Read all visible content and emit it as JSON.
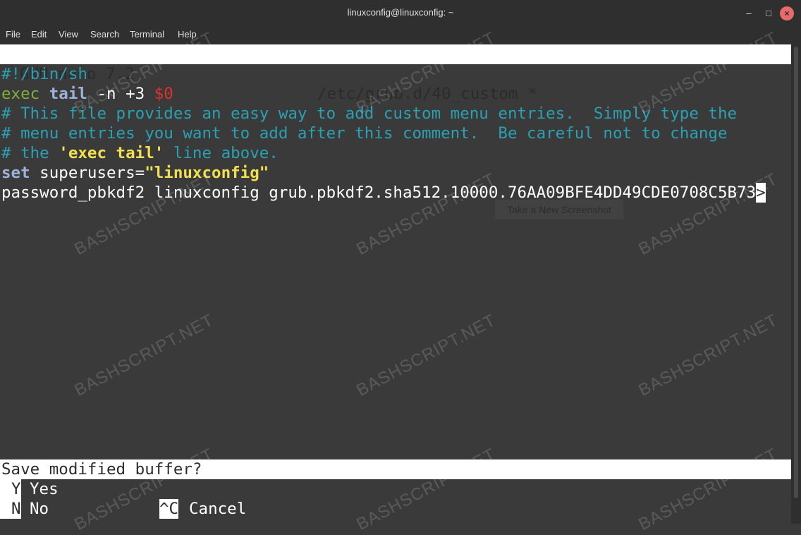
{
  "window": {
    "title": "linuxconfig@linuxconfig: ~"
  },
  "menu": [
    "File",
    "Edit",
    "View",
    "Search",
    "Terminal",
    "Help"
  ],
  "nano": {
    "app": "GNU nano 7.2",
    "file": "/etc/grub.d/40_custom *"
  },
  "buffer": {
    "l1": "#!/bin/sh",
    "l2_exec": "exec",
    "l2_tail": "tail",
    "l2_args": " -n +3 ",
    "l2_var": "$0",
    "l3": "# This file provides an easy way to add custom menu entries.  Simply type the",
    "l4": "# menu entries you want to add after this comment.  Be careful not to change",
    "l5_a": "# the ",
    "l5_b": "'exec tail'",
    "l5_c": " line above.",
    "l6_set": "set",
    "l6_rest": " superusers=",
    "l6_str": "\"linuxconfig\"",
    "l7": "password_pbkdf2 linuxconfig grub.pbkdf2.sha512.10000.76AA09BFE4DD49CDE0708C5B73",
    "l7_more": ">"
  },
  "prompt": "Save modified buffer?",
  "options": {
    "yes_key": "Y",
    "yes_label": "Yes",
    "no_key": "N",
    "no_label": "No",
    "cancel_key": "^C",
    "cancel_label": "Cancel"
  },
  "tooltip": "Take a New Screenshot",
  "watermark": "BASHSCRIPT.NET",
  "colors": {
    "terminal_bg": "#3a3a3a",
    "comment": "#2aa1b3",
    "keyword_green": "#7fae3a",
    "keyword_blue": "#9db3dc",
    "variable_red": "#e03030",
    "string_yellow": "#f0e050"
  }
}
